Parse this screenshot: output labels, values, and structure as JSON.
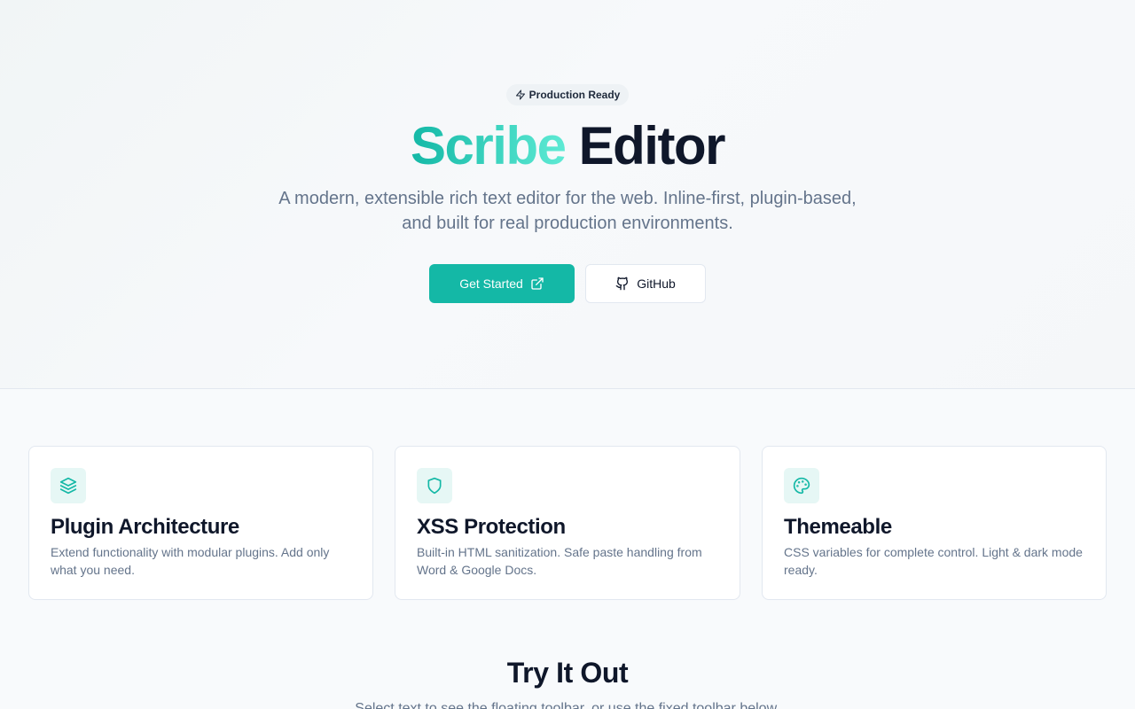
{
  "hero": {
    "badge": "Production Ready",
    "title_accent": "Scribe",
    "title_rest": "Editor",
    "subtitle": "A modern, extensible rich text editor for the web. Inline-first, plugin-based, and built for real production environments.",
    "primary_button": "Get Started",
    "secondary_button": "GitHub"
  },
  "features": [
    {
      "icon": "layers-icon",
      "title": "Plugin Architecture",
      "description": "Extend functionality with modular plugins. Add only what you need."
    },
    {
      "icon": "shield-icon",
      "title": "XSS Protection",
      "description": "Built-in HTML sanitization. Safe paste handling from Word & Google Docs."
    },
    {
      "icon": "palette-icon",
      "title": "Themeable",
      "description": "CSS variables for complete control. Light & dark mode ready."
    }
  ],
  "try_it": {
    "title": "Try It Out",
    "subtitle": "Select text to see the floating toolbar, or use the fixed toolbar below."
  },
  "colors": {
    "accent": "#14b8a6",
    "accent_light": "#5eead4",
    "text": "#0f172a",
    "muted": "#64748b",
    "border": "#e2e8f0"
  }
}
